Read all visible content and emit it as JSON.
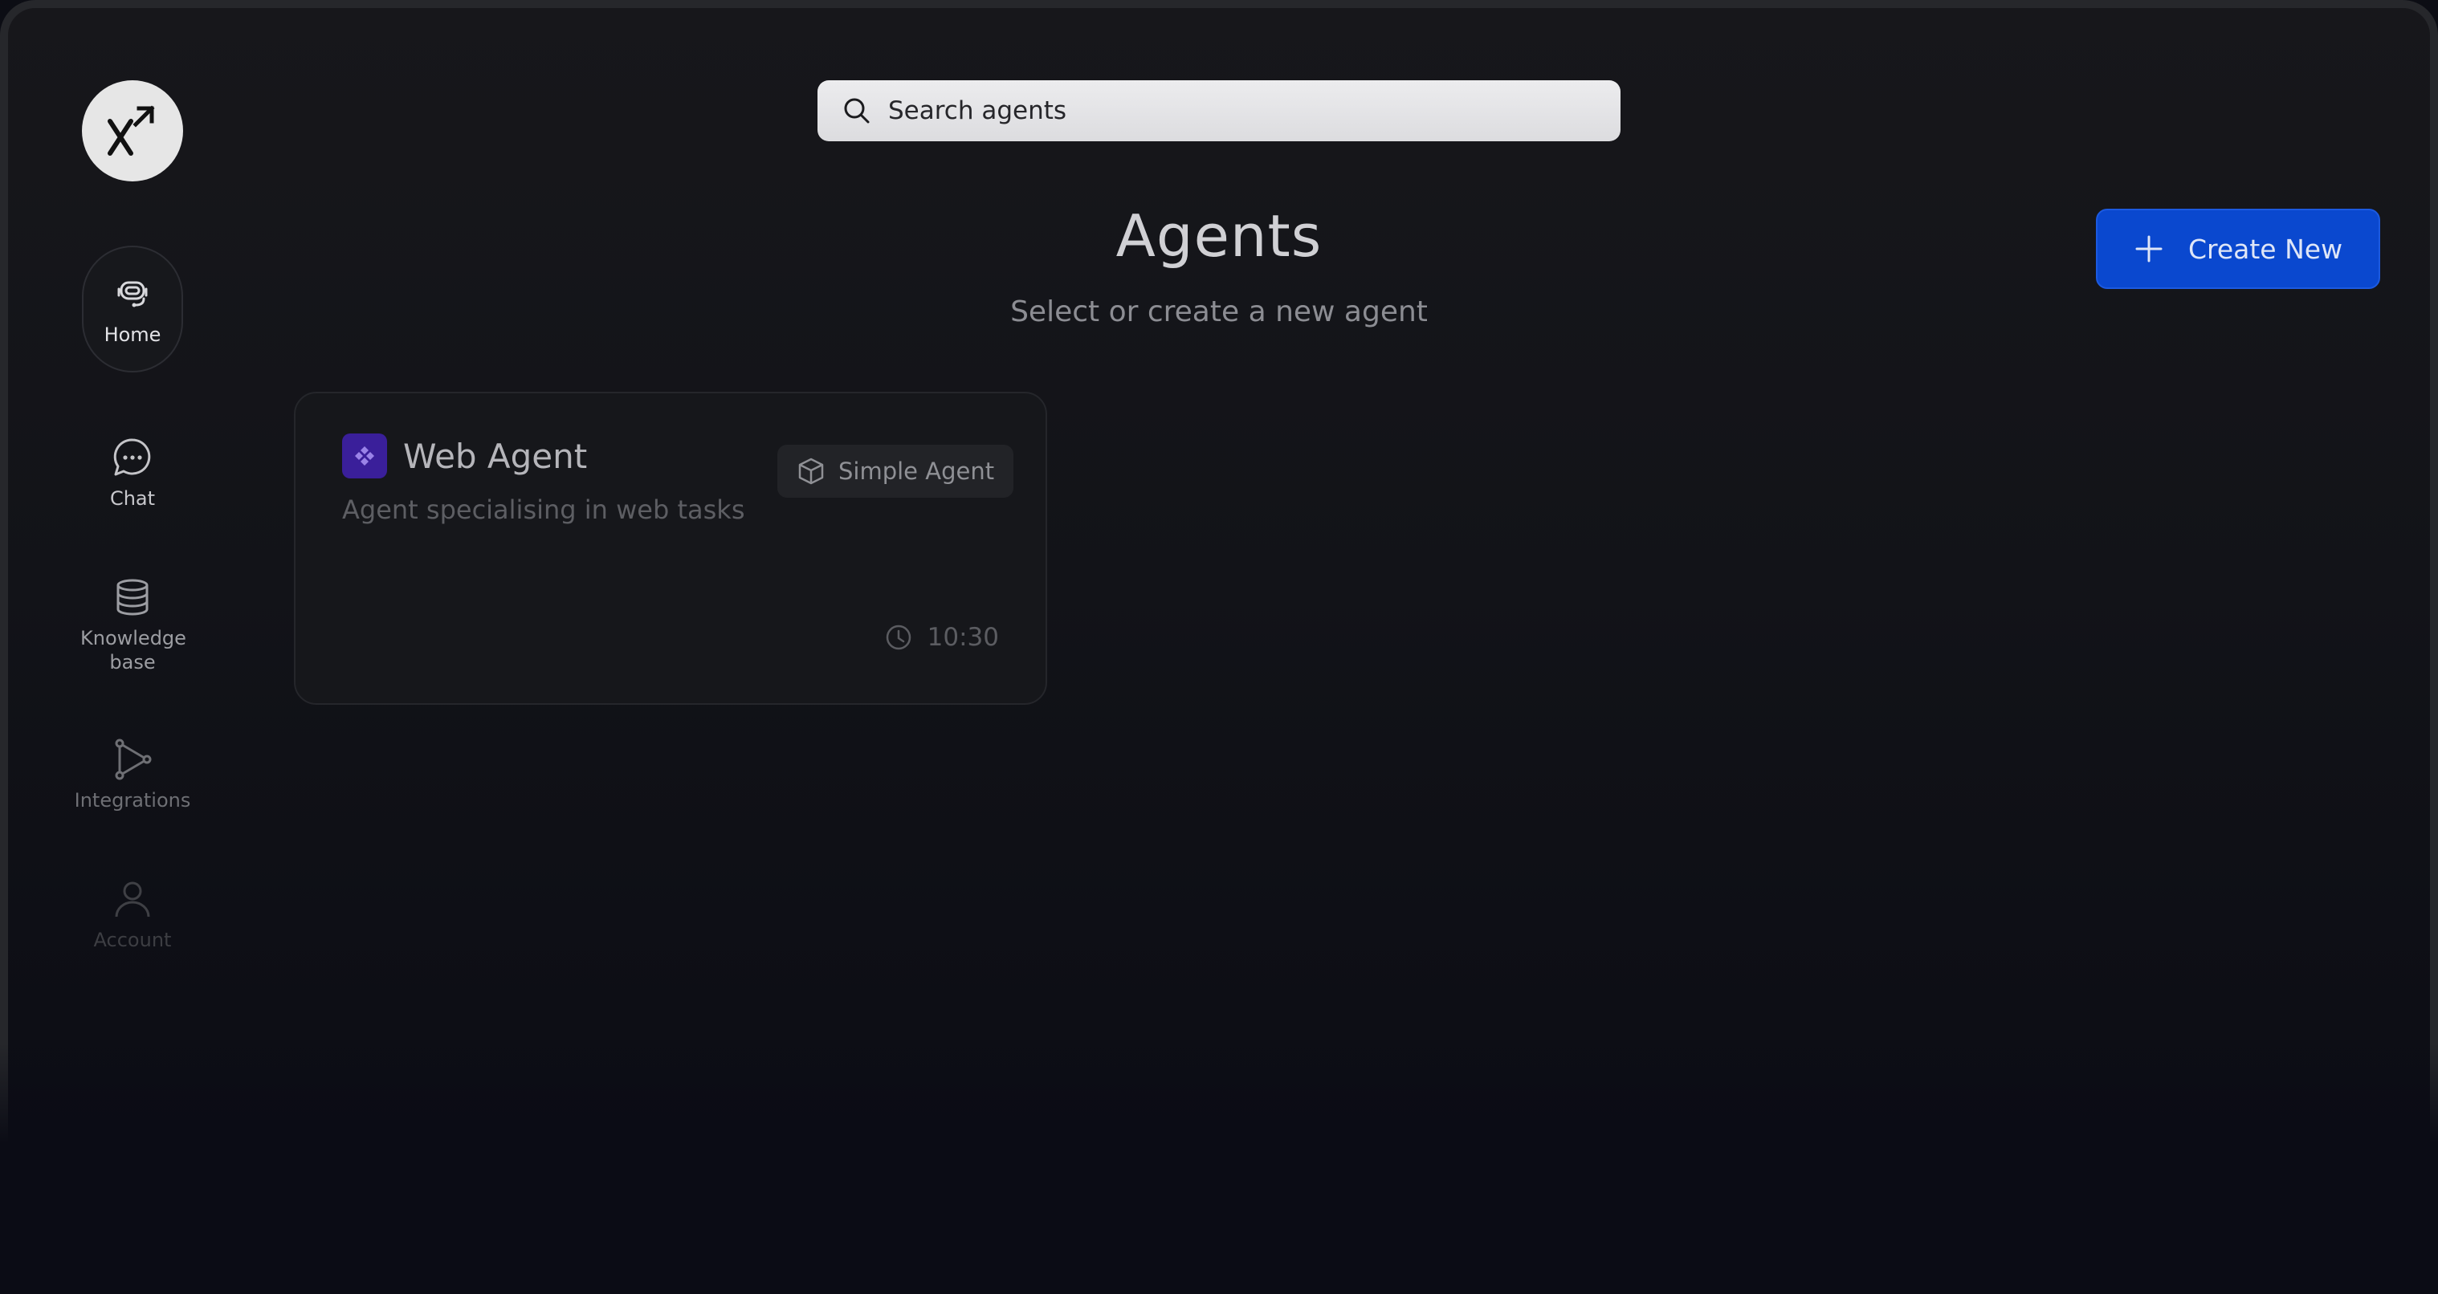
{
  "sidebar": {
    "logo_icon": "x-arrow-logo-icon",
    "items": [
      {
        "label": "Home",
        "icon": "robot-headset-icon",
        "active": true
      },
      {
        "label": "Chat",
        "icon": "chat-bubble-icon"
      },
      {
        "label": "Knowledge base",
        "icon": "database-icon"
      },
      {
        "label": "Integrations",
        "icon": "integrations-graph-icon"
      },
      {
        "label": "Account",
        "icon": "user-icon"
      }
    ]
  },
  "search": {
    "placeholder": "Search agents",
    "value": ""
  },
  "header": {
    "title": "Agents",
    "subtitle": "Select or create a new agent",
    "create_label": "Create New"
  },
  "agents": [
    {
      "name": "Web Agent",
      "description": "Agent specialising in web tasks",
      "type": "Simple Agent",
      "time": "10:30",
      "icon_color": "#3a1f9a"
    }
  ],
  "colors": {
    "accent": "#0a48cf",
    "background": "#121318",
    "card": "#16171b"
  }
}
